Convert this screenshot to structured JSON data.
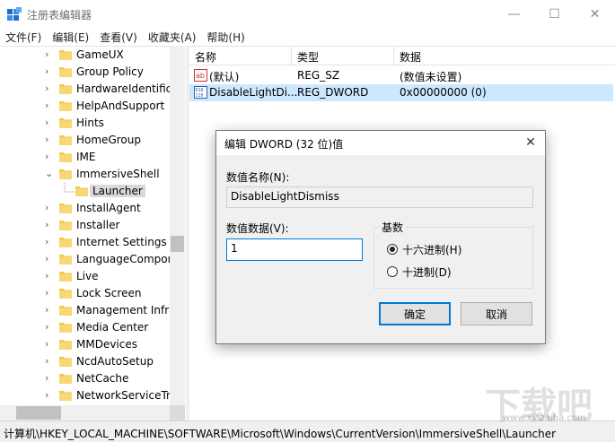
{
  "window": {
    "title": "注册表编辑器",
    "controls": {
      "minimize": "—",
      "maximize": "☐",
      "close": "✕"
    }
  },
  "menu": [
    "文件(F)",
    "编辑(E)",
    "查看(V)",
    "收藏夹(A)",
    "帮助(H)"
  ],
  "tree": {
    "items": [
      {
        "label": "GameUX",
        "expanded": false
      },
      {
        "label": "Group Policy",
        "expanded": false
      },
      {
        "label": "HardwareIdentifica",
        "expanded": false
      },
      {
        "label": "HelpAndSupport",
        "expanded": false
      },
      {
        "label": "Hints",
        "expanded": false
      },
      {
        "label": "HomeGroup",
        "expanded": false
      },
      {
        "label": "IME",
        "expanded": false
      },
      {
        "label": "ImmersiveShell",
        "expanded": true
      },
      {
        "label": "Launcher",
        "selected": true
      },
      {
        "label": "InstallAgent",
        "expanded": false
      },
      {
        "label": "Installer",
        "expanded": false
      },
      {
        "label": "Internet Settings",
        "expanded": false
      },
      {
        "label": "LanguageCompone",
        "expanded": false
      },
      {
        "label": "Live",
        "expanded": false
      },
      {
        "label": "Lock Screen",
        "expanded": false
      },
      {
        "label": "Management Infra",
        "expanded": false
      },
      {
        "label": "Media Center",
        "expanded": false
      },
      {
        "label": "MMDevices",
        "expanded": false
      },
      {
        "label": "NcdAutoSetup",
        "expanded": false
      },
      {
        "label": "NetCache",
        "expanded": false
      },
      {
        "label": "NetworkServiceTrig",
        "expanded": false
      }
    ]
  },
  "list": {
    "columns": [
      "名称",
      "类型",
      "数据"
    ],
    "rows": [
      {
        "icon": "string-value-icon",
        "name": "(默认)",
        "type": "REG_SZ",
        "data": "(数值未设置)"
      },
      {
        "icon": "dword-value-icon",
        "name": "DisableLightDi...",
        "type": "REG_DWORD",
        "data": "0x00000000 (0)",
        "selected": true
      }
    ]
  },
  "status": {
    "path": "计算机\\HKEY_LOCAL_MACHINE\\SOFTWARE\\Microsoft\\Windows\\CurrentVersion\\ImmersiveShell\\Launcher"
  },
  "dialog": {
    "title": "编辑 DWORD (32 位)值",
    "close": "✕",
    "value_name_label": "数值名称(N):",
    "value_name": "DisableLightDismiss",
    "value_data_label": "数值数据(V):",
    "value_data": "1",
    "base_label": "基数",
    "base_options": [
      {
        "label": "十六进制(H)",
        "checked": true
      },
      {
        "label": "十进制(D)",
        "checked": false
      }
    ],
    "ok_label": "确定",
    "cancel_label": "取消"
  },
  "watermark": {
    "text": "下载吧",
    "url": "www.xiazaiba.com"
  },
  "colors": {
    "selection": "#cce8ff",
    "folder": "#f5c746",
    "accent": "#0078d7"
  }
}
